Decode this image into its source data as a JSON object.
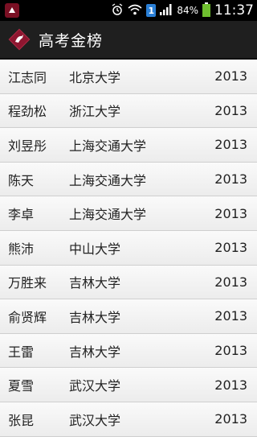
{
  "status_bar": {
    "notification_badge": "1",
    "battery_percent": "84%",
    "time": "11:37"
  },
  "app_bar": {
    "title": "高考金榜"
  },
  "rows": [
    {
      "name": "江志同",
      "school": "北京大学",
      "year": "2013"
    },
    {
      "name": "程劲松",
      "school": "浙江大学",
      "year": "2013"
    },
    {
      "name": "刘昱彤",
      "school": "上海交通大学",
      "year": "2013"
    },
    {
      "name": "陈天",
      "school": "上海交通大学",
      "year": "2013"
    },
    {
      "name": "李卓",
      "school": "上海交通大学",
      "year": "2013"
    },
    {
      "name": "熊沛",
      "school": "中山大学",
      "year": "2013"
    },
    {
      "name": "万胜来",
      "school": "吉林大学",
      "year": "2013"
    },
    {
      "name": "俞贤辉",
      "school": "吉林大学",
      "year": "2013"
    },
    {
      "name": "王雷",
      "school": "吉林大学",
      "year": "2013"
    },
    {
      "name": "夏雪",
      "school": "武汉大学",
      "year": "2013"
    },
    {
      "name": "张昆",
      "school": "武汉大学",
      "year": "2013"
    }
  ],
  "colors": {
    "brand": "#7a1024",
    "app_bar_bg": "#1f1f1f",
    "status_bar_bg": "#000000"
  }
}
